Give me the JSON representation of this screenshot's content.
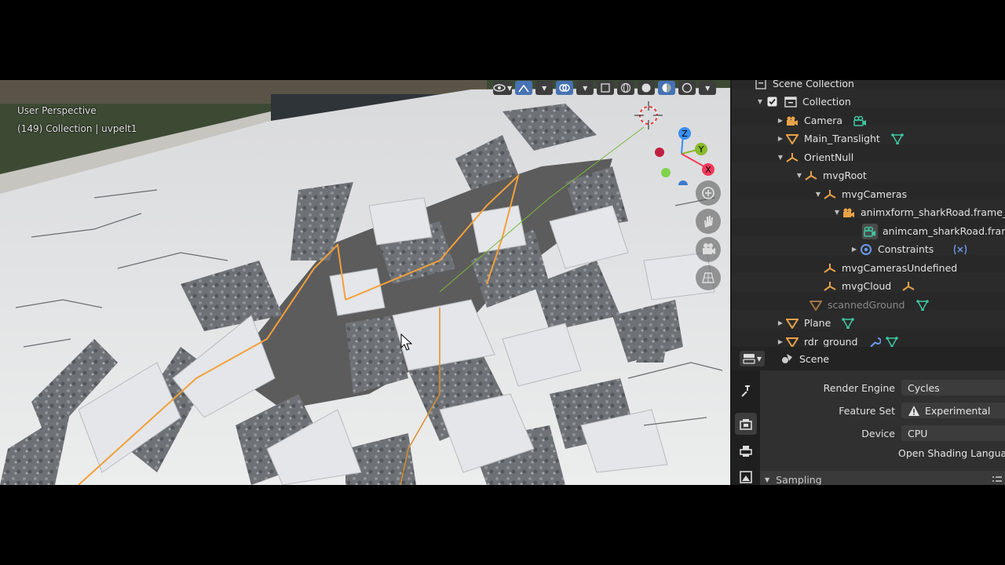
{
  "viewport": {
    "view_name": "User Perspective",
    "frame_info": "(149) Collection | uvpelt1"
  },
  "gizmo": {
    "z": "Z",
    "y": "Y",
    "x": "X"
  },
  "outliner": {
    "root_label": "Scene Collection",
    "items": [
      {
        "label": "Collection",
        "indent": 0,
        "icon": "collection-icon"
      },
      {
        "label": "Camera",
        "indent": 1,
        "icon": "camera-object-icon"
      },
      {
        "label": "Main_Translight",
        "indent": 1,
        "icon": "cone-object-icon"
      },
      {
        "label": "OrientNull",
        "indent": 1,
        "icon": "empty-object-icon"
      },
      {
        "label": "mvgRoot",
        "indent": 2,
        "icon": "empty-object-icon"
      },
      {
        "label": "mvgCameras",
        "indent": 3,
        "icon": "empty-object-icon"
      },
      {
        "label": "animxform_sharkRoad.frame_A",
        "indent": 4,
        "icon": "camera-object-icon"
      },
      {
        "label": "animcam_sharkRoad.frame",
        "indent": 5,
        "icon": "camera-data-icon"
      },
      {
        "label": "Constraints",
        "indent": 4,
        "icon": "constraint-icon"
      },
      {
        "label": "mvgCamerasUndefined",
        "indent": 3,
        "icon": "empty-object-icon"
      },
      {
        "label": "mvgCloud",
        "indent": 3,
        "icon": "empty-object-icon"
      },
      {
        "label": "scannedGround",
        "indent": 2,
        "icon": "cone-object-icon"
      },
      {
        "label": "Plane",
        "indent": 1,
        "icon": "cone-object-icon"
      },
      {
        "label": "rdr_ground",
        "indent": 1,
        "icon": "cone-object-icon"
      }
    ]
  },
  "properties": {
    "context": "Scene",
    "render_engine_label": "Render Engine",
    "render_engine_value": "Cycles",
    "feature_set_label": "Feature Set",
    "feature_set_value": "Experimental",
    "device_label": "Device",
    "device_value": "CPU",
    "osl_label": "Open Shading Language",
    "sampling_label": "Sampling"
  },
  "colors": {
    "accent": "#4772b3",
    "object_orange": "#e8a249",
    "data_green": "#3fc7a0",
    "axis_x": "#f23a5a",
    "axis_y": "#8ab929",
    "axis_z": "#3a8ef0"
  }
}
